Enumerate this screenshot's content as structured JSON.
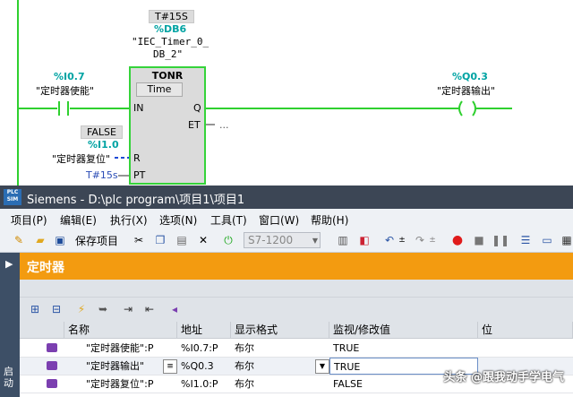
{
  "ladder": {
    "timer_const": "T#15S",
    "db_tag": "%DB6",
    "db_name_line1": "\"IEC_Timer_0_",
    "db_name_line2": "DB_2\"",
    "input_addr": "%I0.7",
    "input_name": "\"定时器使能\"",
    "block_type": "TONR",
    "block_subtype": "Time",
    "pin_in": "IN",
    "pin_q": "Q",
    "pin_et": "ET",
    "et_value": "...",
    "pin_r": "R",
    "pin_pt": "PT",
    "reset_state": "FALSE",
    "reset_addr": "%I1.0",
    "reset_name": "\"定时器复位\"",
    "pt_value": "T#15s",
    "output_addr": "%Q0.3",
    "output_name": "\"定时器输出\""
  },
  "window": {
    "app_icon_text": "PLC SIM",
    "title": "Siemens  -  D:\\plc program\\项目1\\项目1",
    "menu": [
      "项目(P)",
      "编辑(E)",
      "执行(X)",
      "选项(N)",
      "工具(T)",
      "窗口(W)",
      "帮助(H)"
    ],
    "toolbar": {
      "save_project": "保存项目",
      "cpu_select": "S7-1200"
    },
    "panel_title": "定时器",
    "side_label": "启动",
    "table": {
      "columns": [
        "名称",
        "地址",
        "显示格式",
        "监视/修改值",
        "位"
      ],
      "rows": [
        {
          "name": "\"定时器使能\":P",
          "address": "%I0.7:P",
          "format": "布尔",
          "value": "TRUE"
        },
        {
          "name": "\"定时器输出\"",
          "address": "%Q0.3",
          "format": "布尔",
          "value": "TRUE"
        },
        {
          "name": "\"定时器复位\":P",
          "address": "%I1.0:P",
          "format": "布尔",
          "value": "FALSE"
        }
      ]
    }
  },
  "watermark": "头条 @跟我动手学电气"
}
